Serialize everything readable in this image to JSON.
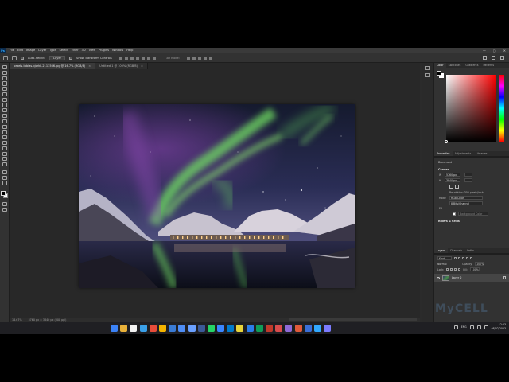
{
  "app": {
    "logo": "Ps",
    "menu": [
      "File",
      "Edit",
      "Image",
      "Layer",
      "Type",
      "Select",
      "Filter",
      "3D",
      "View",
      "Plugins",
      "Window",
      "Help"
    ],
    "window_controls": [
      "—",
      "▢",
      "✕"
    ]
  },
  "options_bar": {
    "auto_select_label": "Auto-Select:",
    "auto_select_target": "Layer",
    "transform_controls_label": "Show Transform Controls",
    "mode_3d_label": "3D Mode:"
  },
  "tabs": [
    {
      "label": "pexels-tobias-bjorkli-2113566.jpg @ 16.7% (RGB/8)",
      "close": "×",
      "active": true
    },
    {
      "label": "Untitled-1 @ 100% (RGB/8)",
      "close": "×",
      "active": false
    }
  ],
  "status_bar": {
    "zoom": "16.67%",
    "doc_size": "5760 px × 3840 px (300 ppi)"
  },
  "color_panel": {
    "tabs": [
      "Color",
      "Swatches",
      "Gradients",
      "Patterns"
    ],
    "active_tab": "Color"
  },
  "properties_panel": {
    "tabs": [
      "Properties",
      "Adjustments",
      "Libraries"
    ],
    "document_label": "Document",
    "canvas_heading": "Canvas",
    "width_label": "W",
    "width_value": "5760 px",
    "height_label": "H",
    "height_value": "3840 px",
    "resolution": "Resolution: 300 pixels/inch",
    "mode_label": "Mode",
    "mode_value": "RGB Color",
    "depth_value": "8 Bits/Channel",
    "fill_label": "Fill",
    "fill_value": "Background Color",
    "rulers_heading": "Rulers & Grids"
  },
  "layers_panel": {
    "tabs": [
      "Layers",
      "Channels",
      "Paths"
    ],
    "search_value": "Kind",
    "blend_mode": "Normal",
    "opacity_label": "Opacity:",
    "opacity_value": "100%",
    "lock_label": "Lock:",
    "fill_label": "Fill:",
    "fill_value": "100%",
    "layers": [
      {
        "name": "Layer 0"
      }
    ]
  },
  "taskbar": {
    "icon_colors": [
      "#3b82f6",
      "#e8b13a",
      "#f2f2f2",
      "#3aa0e8",
      "#e84c3a",
      "#f5b400",
      "#3a7bd5",
      "#4e8df5",
      "#6aa0ff",
      "#3b5998",
      "#25d366",
      "#3a86ff",
      "#007acc",
      "#e8d43a",
      "#2b7de9",
      "#0f9d58",
      "#c0392b",
      "#d94c4c",
      "#8e6ad8",
      "#e05a3a",
      "#3a6fd8",
      "#31a8ff",
      "#7b7bff"
    ],
    "language": "ENG",
    "time": "12:53",
    "date": "08/02/2023"
  },
  "watermark": "MyCELL"
}
